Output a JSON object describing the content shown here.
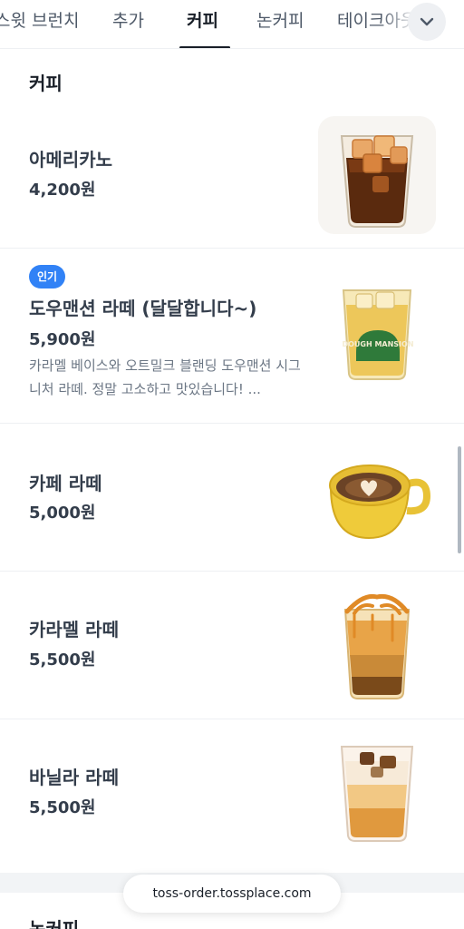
{
  "tabs": [
    {
      "label": "스윗 브런치"
    },
    {
      "label": "추가"
    },
    {
      "label": "커피",
      "active": true
    },
    {
      "label": "논커피"
    },
    {
      "label": "테이크아웃"
    }
  ],
  "more_button": {
    "icon": "chevron-down-icon"
  },
  "section": {
    "title": "커피"
  },
  "items": [
    {
      "name": "아메리카노",
      "price": "4,200원",
      "image": "iced-americano"
    },
    {
      "badge": "인기",
      "name": "도우맨션 라떼 (달달합니다~)",
      "price": "5,900원",
      "description": "카라멜 베이스와 오트밀크 블랜딩 도우맨션 시그니처 라떼. 정말 고소하고 맛있습니다! ...",
      "image": "dough-mansion-latte",
      "cup_label": "DOUGH MANSION"
    },
    {
      "name": "카페 라떼",
      "price": "5,000원",
      "image": "hot-cafe-latte"
    },
    {
      "name": "카라멜 라떼",
      "price": "5,500원",
      "image": "iced-caramel-latte"
    },
    {
      "name": "바닐라 라떼",
      "price": "5,500원",
      "image": "iced-vanilla-latte"
    }
  ],
  "next_section": {
    "title": "논커피"
  },
  "footer": {
    "url": "toss-order.tossplace.com"
  },
  "colors": {
    "accent": "#3182f6",
    "text": "#191f28",
    "muted": "#6b7684"
  }
}
